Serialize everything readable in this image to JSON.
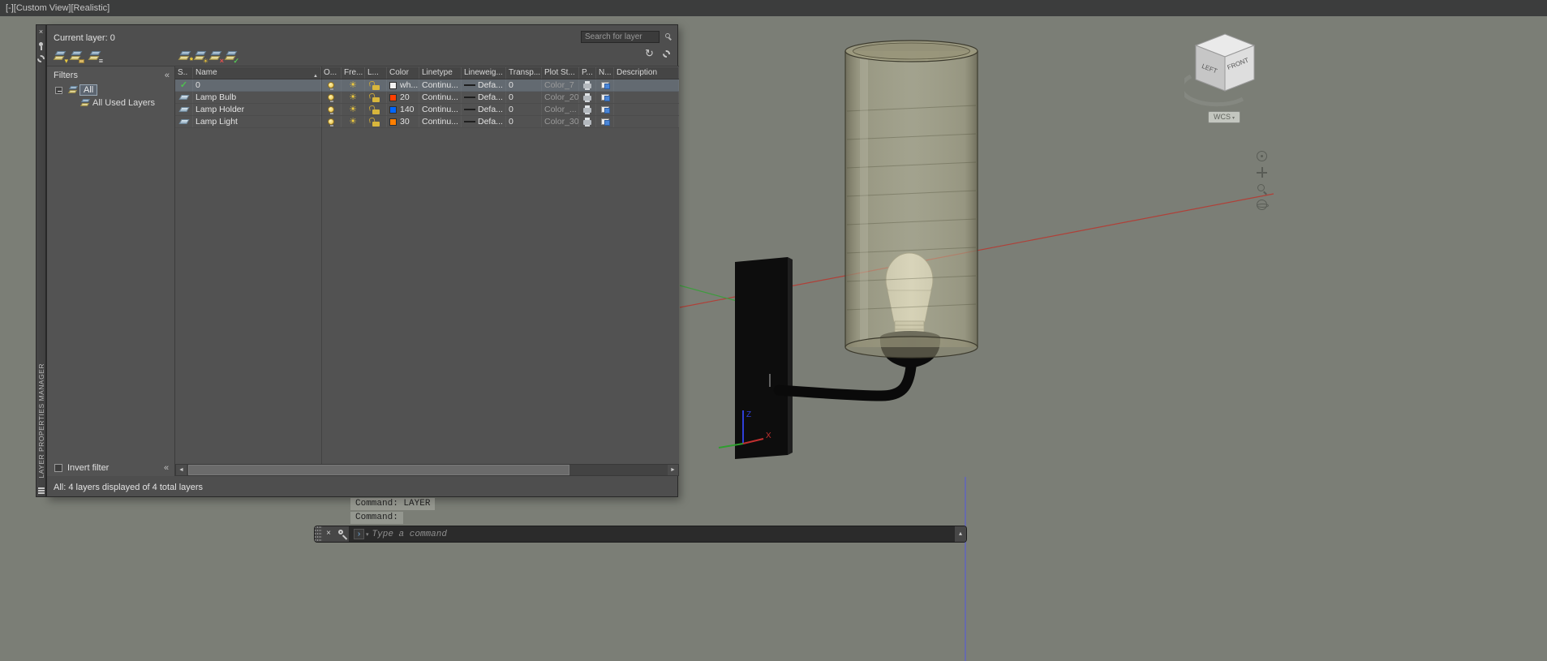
{
  "viewport": {
    "view_label": "[-][Custom View][Realistic]",
    "viewcube": {
      "left_face": "LEFT",
      "front_face": "FRONT",
      "wcs_label": "WCS"
    },
    "ucs_labels": {
      "z": "Z",
      "x": "X"
    }
  },
  "palette": {
    "title_vertical": "LAYER PROPERTIES MANAGER",
    "current_layer": "Current layer: 0",
    "search_placeholder": "Search for layer",
    "filters_header": "Filters",
    "tree": {
      "all": "All",
      "all_used": "All Used Layers"
    },
    "columns": [
      "S..",
      "Name",
      "O...",
      "Fre...",
      "L...",
      "Color",
      "Linetype",
      "Lineweig...",
      "Transp...",
      "Plot St...",
      "P...",
      "N...",
      "Description"
    ],
    "rows": [
      {
        "name": "0",
        "color_label": "wh...",
        "color_hex": "#f2f2f2",
        "linetype": "Continu...",
        "lineweight": "Defa...",
        "transparency": "0",
        "plot_style": "Color_7"
      },
      {
        "name": "Lamp Bulb",
        "color_label": "20",
        "color_hex": "#ff3f00",
        "linetype": "Continu...",
        "lineweight": "Defa...",
        "transparency": "0",
        "plot_style": "Color_20"
      },
      {
        "name": "Lamp Holder",
        "color_label": "140",
        "color_hex": "#0066ff",
        "linetype": "Continu...",
        "lineweight": "Defa...",
        "transparency": "0",
        "plot_style": "Color_..."
      },
      {
        "name": "Lamp Light",
        "color_label": "30",
        "color_hex": "#ff7f00",
        "linetype": "Continu...",
        "lineweight": "Defa...",
        "transparency": "0",
        "plot_style": "Color_30"
      }
    ],
    "invert_filter": "Invert filter",
    "status_bar": "All: 4 layers displayed of 4 total layers"
  },
  "command": {
    "history_line_1": "Command:  LAYER",
    "history_line_2": "Command:",
    "input_placeholder": "Type a command"
  }
}
